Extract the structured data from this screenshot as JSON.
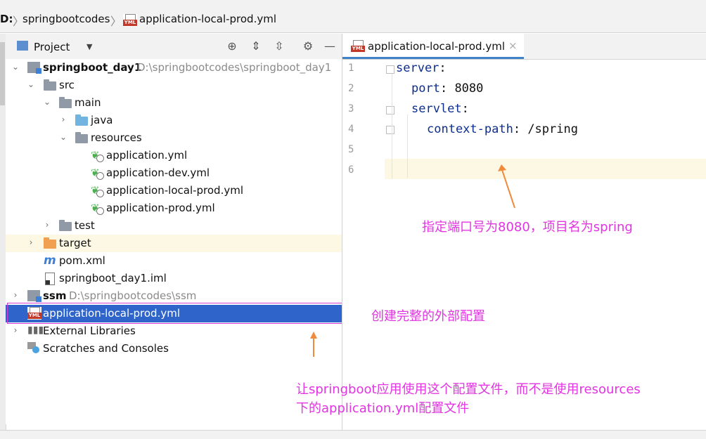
{
  "breadcrumb": {
    "drive": "D:",
    "items": [
      "springbootcodes",
      "application-local-prod.yml"
    ]
  },
  "project_panel": {
    "title": "Project",
    "tree": [
      {
        "label": "springboot_day1",
        "path": "D:\\springbootcodes\\springboot_day1"
      },
      {
        "label": "src"
      },
      {
        "label": "main"
      },
      {
        "label": "java"
      },
      {
        "label": "resources"
      },
      {
        "label": "application.yml"
      },
      {
        "label": "application-dev.yml"
      },
      {
        "label": "application-local-prod.yml"
      },
      {
        "label": "application-prod.yml"
      },
      {
        "label": "test"
      },
      {
        "label": "target"
      },
      {
        "label": "pom.xml"
      },
      {
        "label": "springboot_day1.iml"
      },
      {
        "label": "ssm",
        "path": "D:\\springbootcodes\\ssm"
      },
      {
        "label": "application-local-prod.yml"
      },
      {
        "label": "External Libraries"
      },
      {
        "label": "Scratches and Consoles"
      }
    ]
  },
  "editor": {
    "tab_label": "application-local-prod.yml",
    "line_numbers": [
      "1",
      "2",
      "3",
      "4",
      "5",
      "6"
    ],
    "lines": [
      {
        "key": "server",
        "sep": ":",
        "value": ""
      },
      {
        "key": "port",
        "sep": ":",
        "value": " 8080"
      },
      {
        "key": "servlet",
        "sep": ":",
        "value": ""
      },
      {
        "key": "context-path",
        "sep": ":",
        "value": " /spring"
      }
    ]
  },
  "annotations": {
    "port_note": "指定端口号为8080，项目名为spring",
    "create_note": "创建完整的外部配置",
    "usage_line1": "让springboot应用使用这个配置文件，而不是使用resources",
    "usage_line2": "下的application.yml配置文件"
  },
  "colors": {
    "annotation": "#e234e2",
    "selection": "#2f65ca",
    "arrow": "#f08a3c"
  }
}
